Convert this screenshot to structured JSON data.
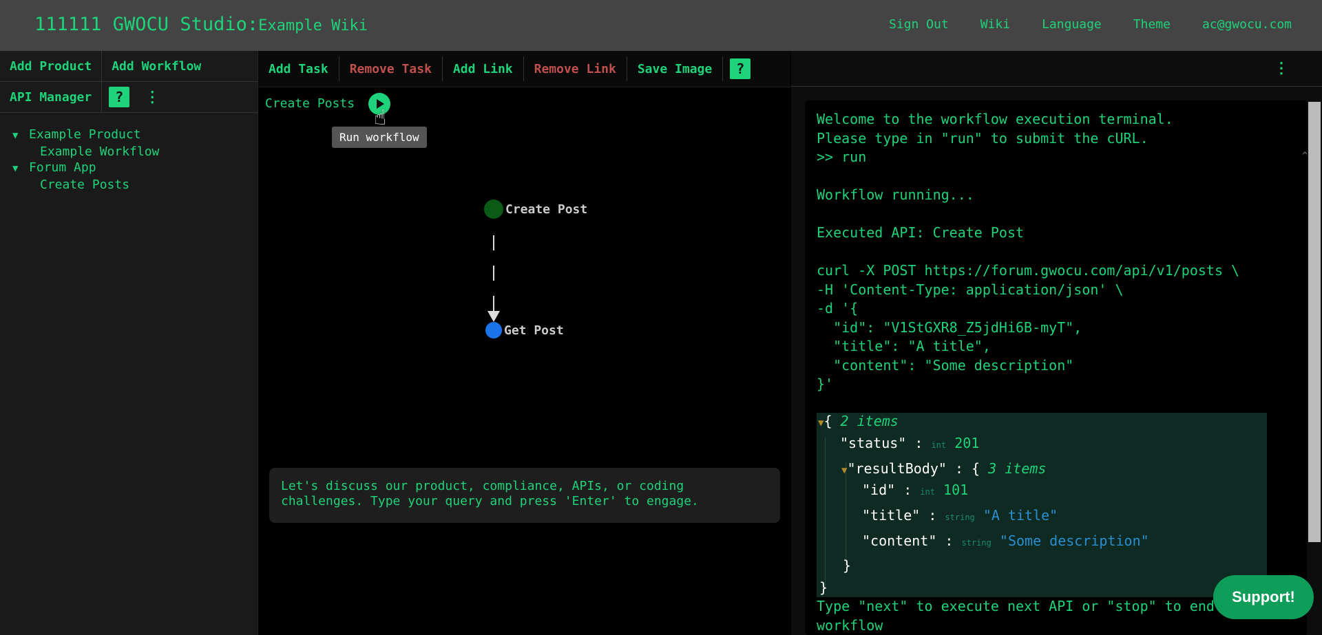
{
  "header": {
    "brand": "111111 GWOCU Studio:",
    "brand_sub": "Example Wiki",
    "nav": [
      "Sign Out",
      "Wiki",
      "Language",
      "Theme",
      "ac@gwocu.com"
    ]
  },
  "sidebar": {
    "add_product": "Add Product",
    "add_workflow": "Add Workflow",
    "api_manager": "API Manager",
    "help": "?",
    "menu": "⋮",
    "tree": [
      {
        "arrow": "▼",
        "label": "Example Product",
        "workflows": [
          "Example Workflow"
        ]
      },
      {
        "arrow": "▼",
        "label": "Forum App",
        "workflows": [
          "Create Posts"
        ]
      }
    ]
  },
  "toolbar": {
    "add_task": "Add Task",
    "remove_task": "Remove Task",
    "add_link": "Add Link",
    "remove_link": "Remove Link",
    "save_image": "Save Image",
    "help": "?"
  },
  "canvas": {
    "workflow_title": "Create Posts",
    "tooltip": "Run workflow",
    "nodes": [
      {
        "label": "Create Post",
        "color": "#0b5a16"
      },
      {
        "label": "Get Post",
        "color": "#1a73e8"
      }
    ],
    "chat_text": "Let's discuss our product, compliance, APIs, or coding\nchallenges. Type your query and press 'Enter' to engage."
  },
  "right_panel": {
    "menu": "⋮",
    "terminal_lines": "Welcome to the workflow execution terminal.\nPlease type in \"run\" to submit the cURL.\n>> run\n\nWorkflow running...\n\nExecuted API: Create Post\n\ncurl -X POST https://forum.gwocu.com/api/v1/posts \\\n-H 'Content-Type: application/json' \\\n-d '{\n  \"id\": \"V1StGXR8_Z5jdHi6B-myT\",\n  \"title\": \"A title\",\n  \"content\": \"Some description\"\n}'",
    "json": {
      "root_count": "2 items",
      "status_key": "\"status\"",
      "status_type": "int",
      "status_val": "201",
      "result_key": "\"resultBody\"",
      "result_count": "3 items",
      "id_key": "\"id\"",
      "id_type": "int",
      "id_val": "101",
      "title_key": "\"title\"",
      "title_type": "string",
      "title_val": "\"A title\"",
      "content_key": "\"content\"",
      "content_type": "string",
      "content_val": "\"Some description\""
    },
    "terminal_bottom": "Type \"next\" to execute next API or \"stop\" to end\nworkflow"
  },
  "support": "Support!"
}
